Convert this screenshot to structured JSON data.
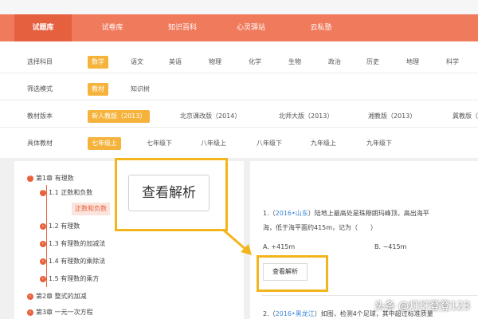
{
  "nav": {
    "items": [
      {
        "label": "试题库",
        "active": true
      },
      {
        "label": "试卷库",
        "active": false
      },
      {
        "label": "知识百科",
        "active": false
      },
      {
        "label": "心灵驿站",
        "active": false
      },
      {
        "label": "云私塾",
        "active": false
      }
    ]
  },
  "filters": {
    "subject": {
      "label": "选择科目",
      "options": [
        "数学",
        "语文",
        "英语",
        "物理",
        "化学",
        "生物",
        "政治",
        "历史",
        "地理",
        "科学"
      ],
      "selected": "数学"
    },
    "mode": {
      "label": "筛选模式",
      "options": [
        "教材",
        "知识树"
      ],
      "selected": "教材"
    },
    "edition": {
      "label": "教材版本",
      "options": [
        "新人教版（2013）",
        "北京课改版（2014）",
        "北师大版（2013）",
        "湘教版（2013）",
        "冀教版（"
      ],
      "selected": "新人教版（2013）"
    },
    "textbook": {
      "label": "具体教材",
      "options": [
        "七年级上",
        "七年级下",
        "八年级上",
        "八年级下",
        "九年级上",
        "九年级下"
      ],
      "selected": "七年级上"
    }
  },
  "tree": {
    "chapter1": "第1章 有理数",
    "sec11": "1.1 正数和负数",
    "leaf": "正数和负数",
    "sec12": "1.2 有理数",
    "sec13": "1.3 有理数的加减法",
    "sec14": "1.4 有理数的乘除法",
    "sec15": "1.5 有理数的乘方",
    "chapter2": "第2章 整式的加减",
    "chapter3": "第3章 一元一次方程"
  },
  "question1": {
    "num": "1.（",
    "source": "2016•山东",
    "text_a": "）陆地上最高处是珠穆朗玛峰顶，高出海平",
    "text_b": "海，低于海平面约415m，记为（　　）",
    "option_a": "A. +415m",
    "option_b": "B. −415m"
  },
  "question2": {
    "num": "2.（",
    "source": "2016•黑龙江",
    "text": "）如图，检测4个足球，其中超过标准质量"
  },
  "buttons": {
    "analysis_small": "查看解析",
    "analysis_callout": "查看解析"
  },
  "watermark": "头条 @灯灯登登123",
  "colors": {
    "nav": "#f07a5c",
    "nav_active": "#e5603f",
    "selected": "#f5b33c",
    "highlight": "#f3b51c",
    "link": "#3a86d6"
  }
}
